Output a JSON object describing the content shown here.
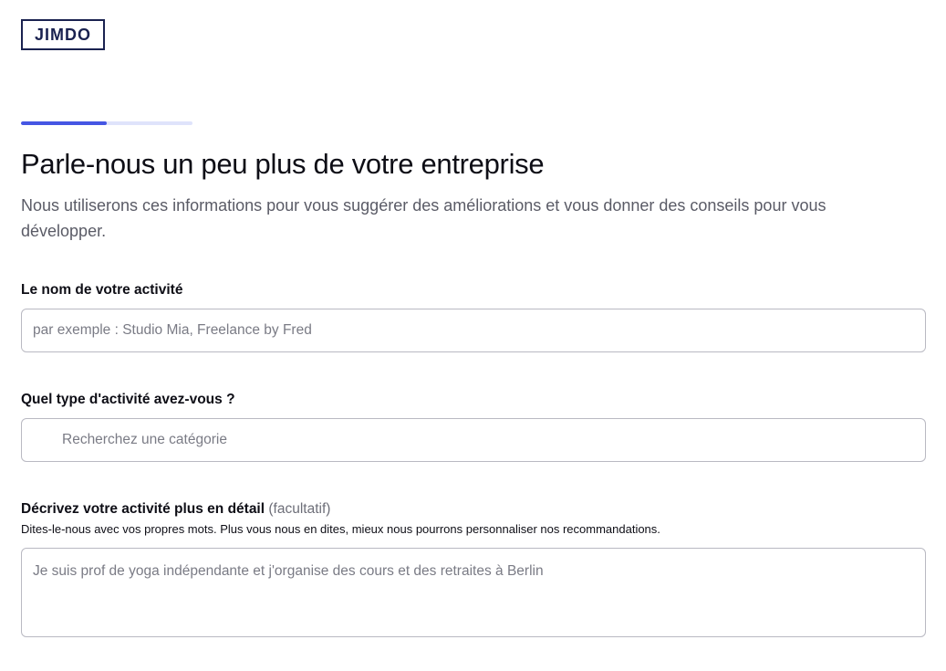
{
  "brand": {
    "logo_text": "JIMDO"
  },
  "progress": {
    "value_percent": 50
  },
  "header": {
    "title": "Parle-nous un peu plus de votre entreprise",
    "subtitle": "Nous utiliserons ces informations pour vous suggérer des améliorations et vous donner des conseils pour vous développer."
  },
  "form": {
    "business_name": {
      "label": "Le nom de votre activité",
      "placeholder": "par exemple : Studio Mia, Freelance by Fred",
      "value": ""
    },
    "business_type": {
      "label": "Quel type d'activité avez-vous ?",
      "placeholder": "Recherchez une catégorie",
      "icon": "search-icon",
      "value": ""
    },
    "description": {
      "label": "Décrivez votre activité plus en détail",
      "optional_text": "(facultatif)",
      "helper": "Dites-le-nous avec vos propres mots. Plus vous nous en dites, mieux nous pourrons personnaliser nos recommandations.",
      "placeholder": "Je suis prof de yoga indépendante et j'organise des cours et des retraites à Berlin",
      "value": ""
    }
  },
  "colors": {
    "brand_navy": "#1a2250",
    "progress_fill": "#4556e3",
    "progress_track": "#dfe3fb",
    "text_primary": "#0e0e16",
    "text_secondary": "#5a5b66",
    "field_border": "#b9b9c2"
  }
}
